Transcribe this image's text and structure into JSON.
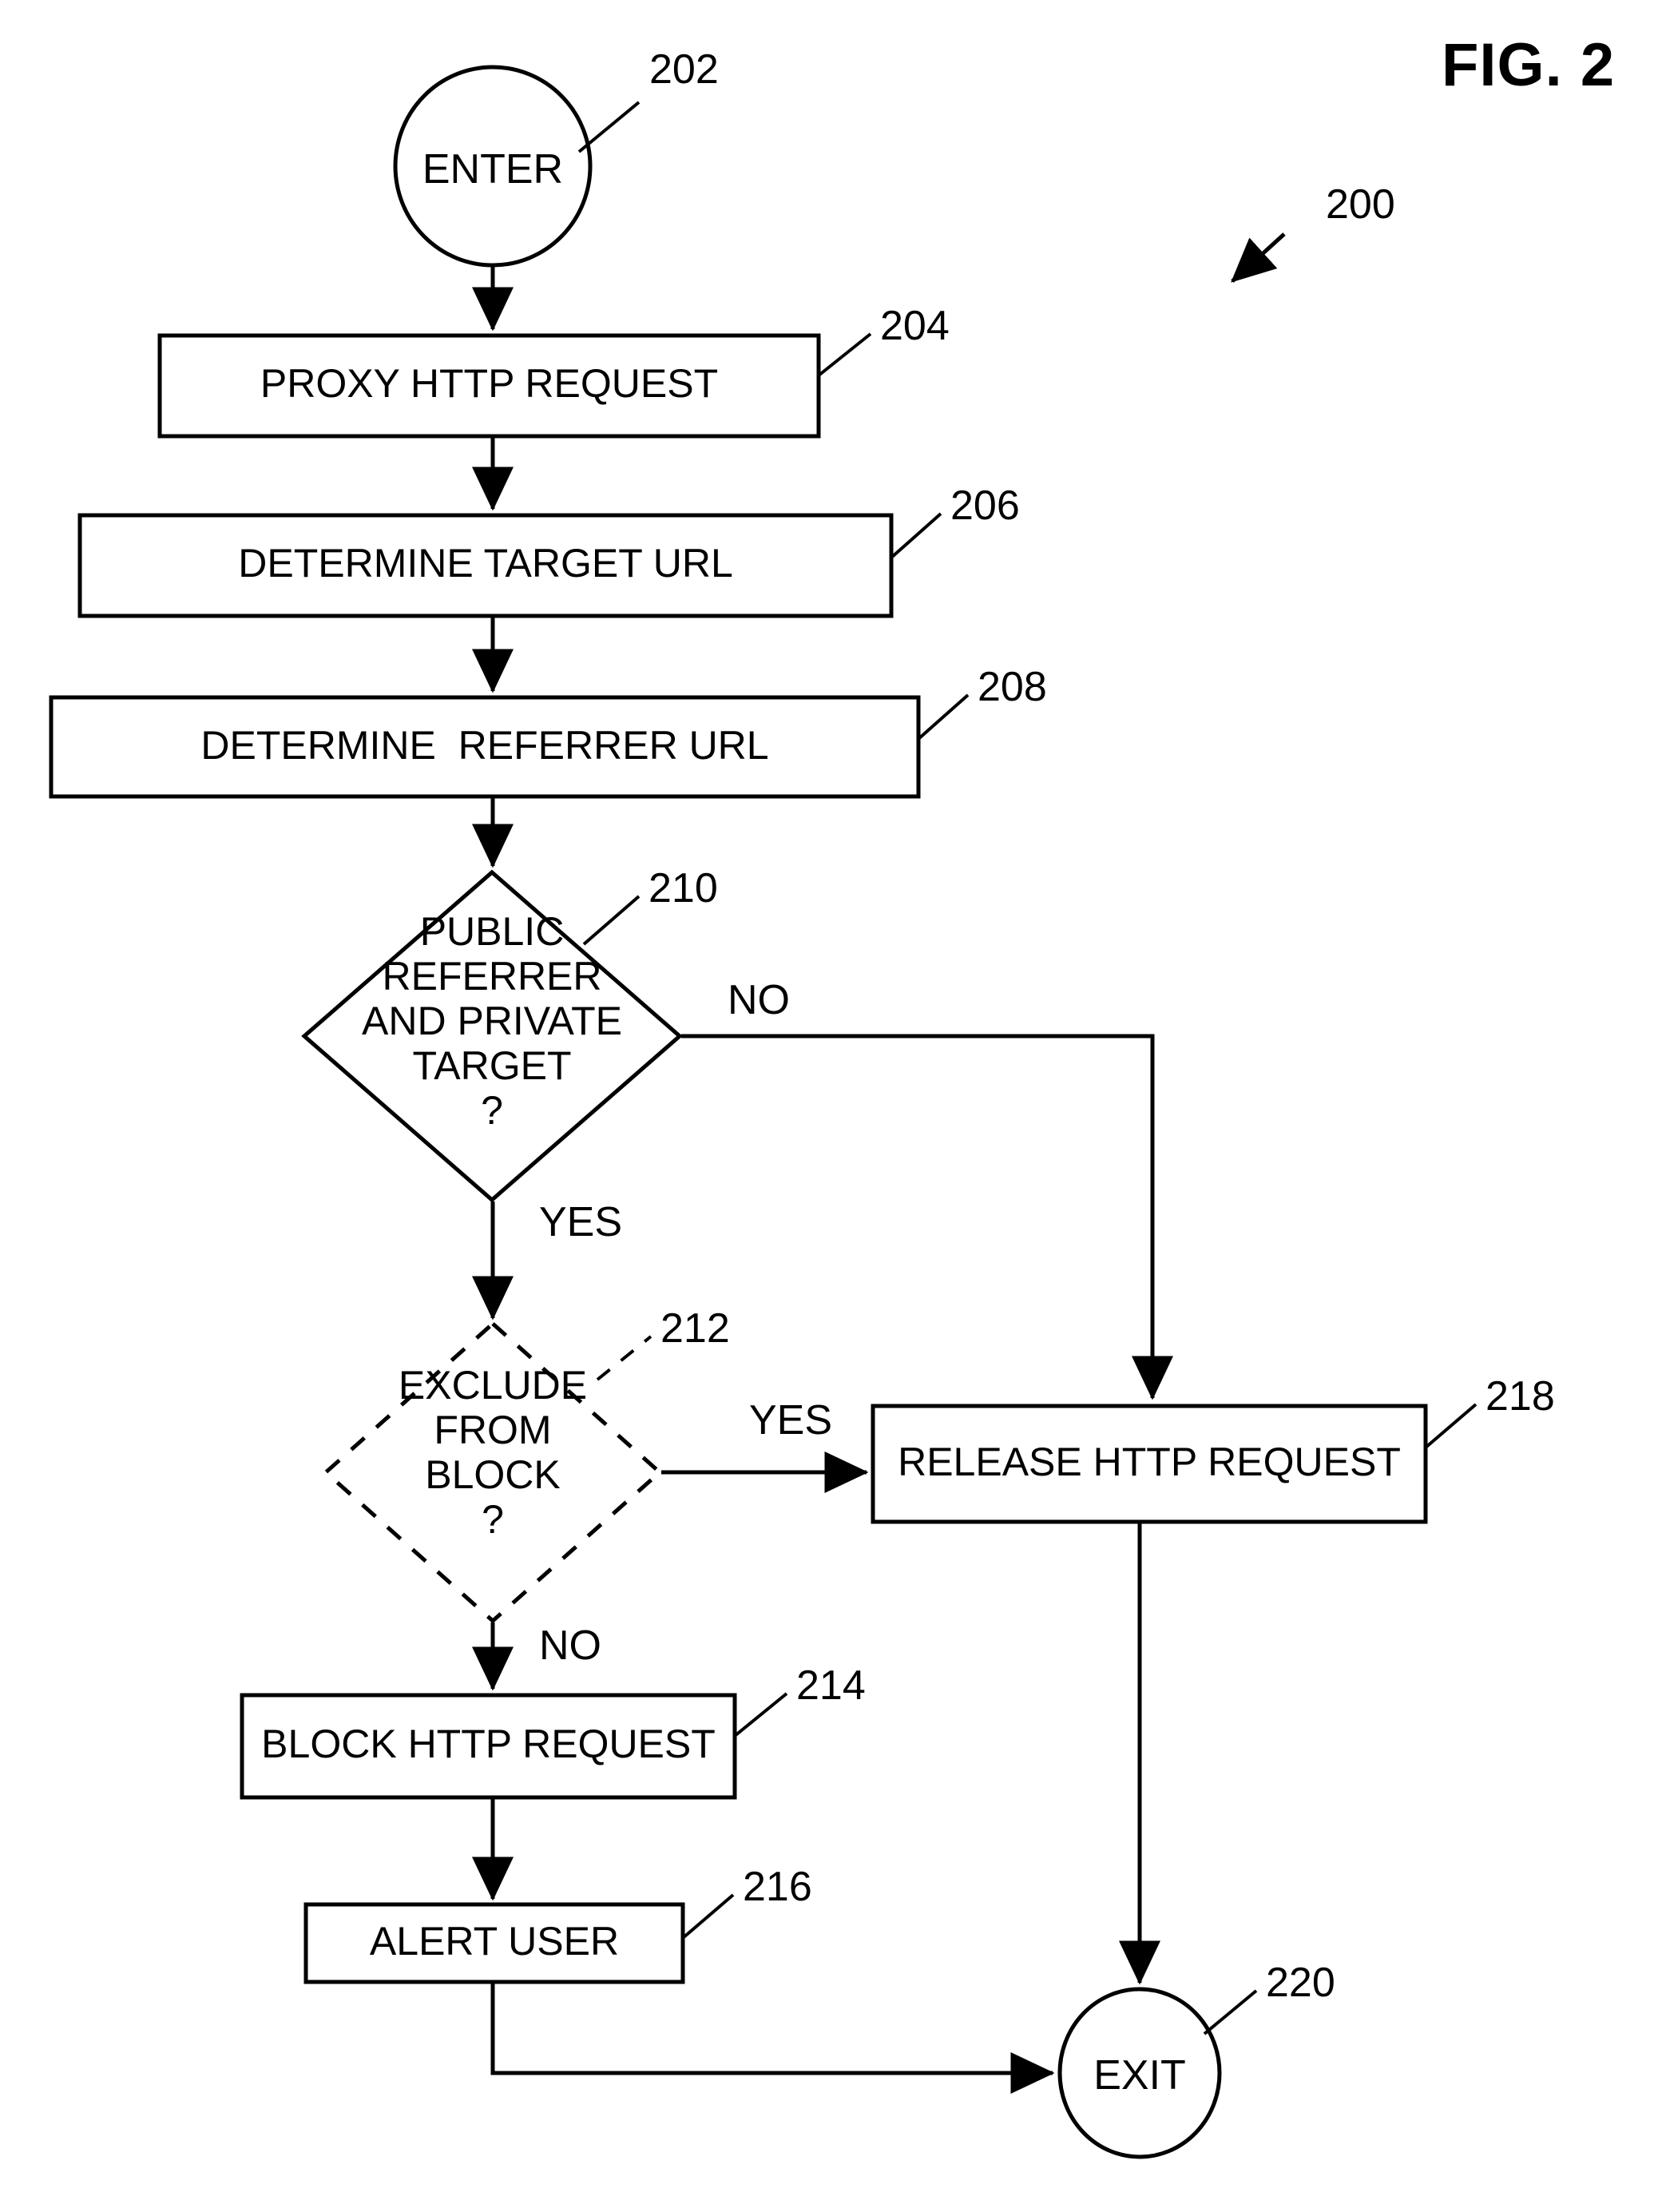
{
  "figure": {
    "title": "FIG. 2",
    "diagram_ref": "200",
    "type": "flowchart"
  },
  "nodes": [
    {
      "ref": "202",
      "shape": "circle",
      "label": "ENTER",
      "style": "solid"
    },
    {
      "ref": "204",
      "shape": "process",
      "label": "PROXY HTTP REQUEST",
      "style": "solid"
    },
    {
      "ref": "206",
      "shape": "process",
      "label": "DETERMINE TARGET URL",
      "style": "solid"
    },
    {
      "ref": "208",
      "shape": "process",
      "label": "DETERMINE  REFERRER URL",
      "style": "solid"
    },
    {
      "ref": "210",
      "shape": "decision",
      "label": "PUBLIC\nREFERRER\nAND PRIVATE\nTARGET\n?",
      "style": "solid"
    },
    {
      "ref": "212",
      "shape": "decision",
      "label": "EXCLUDE\nFROM\nBLOCK\n?",
      "style": "dashed"
    },
    {
      "ref": "214",
      "shape": "process",
      "label": "BLOCK HTTP REQUEST",
      "style": "solid"
    },
    {
      "ref": "216",
      "shape": "process",
      "label": "ALERT USER",
      "style": "solid"
    },
    {
      "ref": "218",
      "shape": "process",
      "label": "RELEASE HTTP REQUEST",
      "style": "solid"
    },
    {
      "ref": "220",
      "shape": "circle",
      "label": "EXIT",
      "style": "solid"
    }
  ],
  "node_text": {
    "enter": "ENTER",
    "proxy_http_request": "PROXY HTTP REQUEST",
    "determine_target_url": "DETERMINE TARGET URL",
    "determine_referrer_url": "DETERMINE  REFERRER URL",
    "decision_210_line1": "PUBLIC",
    "decision_210_line2": "REFERRER",
    "decision_210_line3": "AND PRIVATE",
    "decision_210_line4": "TARGET",
    "decision_210_line5": "?",
    "decision_212_line1": "EXCLUDE",
    "decision_212_line2": "FROM",
    "decision_212_line3": "BLOCK",
    "decision_212_line4": "?",
    "block_http_request": "BLOCK HTTP REQUEST",
    "alert_user": "ALERT USER",
    "release_http_request": "RELEASE HTTP REQUEST",
    "exit": "EXIT"
  },
  "ref_numbers": {
    "n200": "200",
    "n202": "202",
    "n204": "204",
    "n206": "206",
    "n208": "208",
    "n210": "210",
    "n212": "212",
    "n214": "214",
    "n216": "216",
    "n218": "218",
    "n220": "220"
  },
  "branch_labels": {
    "d210_no": "NO",
    "d210_yes": "YES",
    "d212_yes": "YES",
    "d212_no": "NO"
  },
  "edges": [
    {
      "from": "202",
      "to": "204",
      "label": ""
    },
    {
      "from": "204",
      "to": "206",
      "label": ""
    },
    {
      "from": "206",
      "to": "208",
      "label": ""
    },
    {
      "from": "208",
      "to": "210",
      "label": ""
    },
    {
      "from": "210",
      "to": "218",
      "label": "NO"
    },
    {
      "from": "210",
      "to": "212",
      "label": "YES"
    },
    {
      "from": "212",
      "to": "218",
      "label": "YES"
    },
    {
      "from": "212",
      "to": "214",
      "label": "NO"
    },
    {
      "from": "214",
      "to": "216",
      "label": ""
    },
    {
      "from": "216",
      "to": "220",
      "label": ""
    },
    {
      "from": "218",
      "to": "220",
      "label": ""
    }
  ],
  "colors": {
    "stroke": "#000000",
    "background": "#ffffff",
    "text": "#000000"
  }
}
